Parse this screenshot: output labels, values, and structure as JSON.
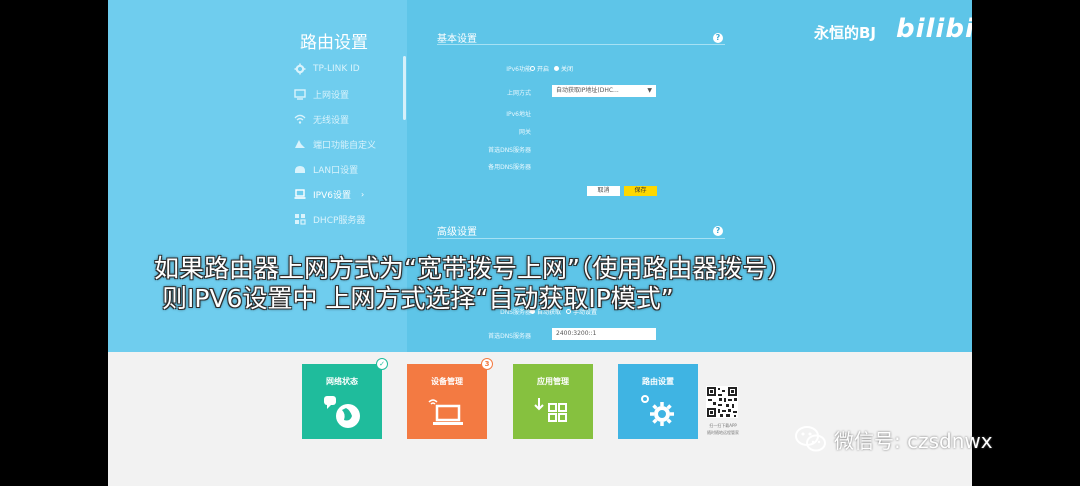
{
  "watermark": {
    "text": "永恒的BJ",
    "logo": "bilibili"
  },
  "sidebar": {
    "title": "路由设置",
    "items": [
      {
        "label": "TP-LINK ID",
        "icon": "gear-icon"
      },
      {
        "label": "上网设置",
        "icon": "monitor-icon"
      },
      {
        "label": "无线设置",
        "icon": "wifi-icon"
      },
      {
        "label": "端口功能自定义",
        "icon": "ports-icon"
      },
      {
        "label": "LAN口设置",
        "icon": "lan-icon"
      },
      {
        "label": "IPV6设置",
        "icon": "laptop-icon",
        "arrow": "›"
      },
      {
        "label": "DHCP服务器",
        "icon": "dhcp-icon"
      }
    ]
  },
  "basic": {
    "title": "基本设置",
    "help": "?",
    "ipv6_label": "IPv6功能",
    "ipv6_on": "开启",
    "ipv6_off": "关闭",
    "wan_label": "上网方式",
    "wan_value": "自动获取IP地址(DHC...",
    "addr_label": "IPv6地址",
    "gateway_label": "网关",
    "dns1_label": "首选DNS服务器",
    "dns2_label": "备用DNS服务器",
    "cancel": "取消",
    "save": "保存"
  },
  "advanced": {
    "title": "高级设置",
    "help": "?",
    "dns_label": "DNS服务器",
    "dns_auto": "自动获取",
    "dns_manual": "手动设置",
    "dns1_label": "首选DNS服务器",
    "dns1_value": "2400:3200::1"
  },
  "subtitle": {
    "line1": "如果路由器上网方式为“宽带拨号上网”（使用路由器拨号）",
    "line2": "则IPV6设置中 上网方式选择“自动获取IP模式”"
  },
  "tiles": [
    {
      "label": "网络状态",
      "color": "#1fbc9c",
      "badge": "✓",
      "icon": "globe-icon"
    },
    {
      "label": "设备管理",
      "color": "#f37a42",
      "badge": "3",
      "icon": "laptop-icon"
    },
    {
      "label": "应用管理",
      "color": "#86c13f",
      "badge": "",
      "icon": "apps-icon"
    },
    {
      "label": "路由设置",
      "color": "#3fb4e3",
      "badge": "",
      "icon": "gear-icon"
    }
  ],
  "qr": {
    "caption1": "扫一扫下载APP",
    "caption2": "随时随地远程管家"
  },
  "wechat": {
    "text": "微信号: czsdnwx"
  }
}
